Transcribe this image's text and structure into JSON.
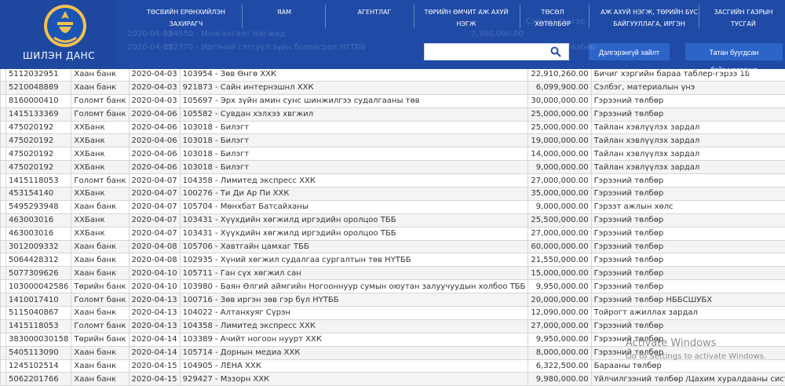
{
  "logo": {
    "title": "ШИЛЭН ДАНС"
  },
  "nav": [
    "ТӨСВИЙН ЕРӨНХИЙЛЭН ЗАХИРАГЧ",
    "ЯАМ",
    "АГЕНТЛАГ",
    "ТӨРИЙН ӨМЧИТ АЖ АХУЙ НЭГЖ",
    "ТӨСӨЛ ХӨТӨЛБӨР",
    "АЖ АХУЙ НЭГЖ, ТӨРИЙН БУС БАЙГУУЛЛАГА, ИРГЭН",
    "ЗАСГИЙН ГАЗРЫН ТУСГАЙ"
  ],
  "search": {
    "placeholder": ""
  },
  "buttons": {
    "advanced": "Дэлгэрэнгүй хайлт",
    "download": "Татан буугдсан байгууллагууд"
  },
  "ghost": {
    "r1": "104550 - Монгалгалт Нагжид",
    "r2": "102770 - Иргэний сэтгүүл зүйн боловсрол НҮТББ",
    "r3": "Сэрүүн тэнгэр",
    "r4": "7,390,000.00",
    "r5": "26,000,000.00",
    "r6": "Гэрээний төлбөр",
    "date1": "2020-04-03",
    "date2": "2020-04-03"
  },
  "rows": [
    [
      "5112032951",
      "Хаан банк",
      "2020-04-03",
      "103954 - Зөв Өнгө ХХК",
      "22,910,260.00",
      "Бичиг хэргийн бараа таблер-гэрээ 18"
    ],
    [
      "5210048889",
      "Хаан банк",
      "2020-04-03",
      "921873 - Сайн интернэшнл ХХК",
      "6,099,900.00",
      "Сэлбэг, материалын үнэ"
    ],
    [
      "8160000410",
      "Голомт банк",
      "2020-04-03",
      "105697 - Эрх зүйн амин сунс шинжилгээ судалгааны төв",
      "30,000,000.00",
      "Гэрээний төлбөр"
    ],
    [
      "1415133369",
      "Голомт банк",
      "2020-04-06",
      "105582 - Сувдан хэлхээ хвгжил",
      "25,000,000.00",
      "Гэрээний төлбөр"
    ],
    [
      "475020192",
      "ХХБанк",
      "2020-04-06",
      "103018 - Билэгт",
      "25,000,000.00",
      "Тайлан хэвлүүлэх зардал"
    ],
    [
      "475020192",
      "ХХБанк",
      "2020-04-06",
      "103018 - Билэгт",
      "19,000,000.00",
      "Тайлан хэвлүүлэх зардал"
    ],
    [
      "475020192",
      "ХХБанк",
      "2020-04-06",
      "103018 - Билэгт",
      "14,000,000.00",
      "Тайлан хэвлүүлэх зардал"
    ],
    [
      "475020192",
      "ХХБанк",
      "2020-04-06",
      "103018 - Билэгт",
      "9,000,000.00",
      "Тайлан хэвлүүлэх зардал"
    ],
    [
      "1415118053",
      "Голомт банк",
      "2020-04-07",
      "104358 - Лимитед экспресс ХХК",
      "27,000,000.00",
      "Гэрээний төлбөр"
    ],
    [
      "453154140",
      "ХХБанк",
      "2020-04-07",
      "100276 - Ти Ди Ар Пи ХХК",
      "35,000,000.00",
      "Гэрээний төлбөр"
    ],
    [
      "5495293948",
      "Хаан банк",
      "2020-04-07",
      "105704 - Мөнхбат Батсайханы",
      "9,000,000.00",
      "Гэрээт ажлын хөлс"
    ],
    [
      "463003016",
      "ХХБанк",
      "2020-04-07",
      "103431 - Хүүхдийн хөгжилд иргэдийн оролцоо ТББ",
      "25,500,000.00",
      "Гэрээний төлбөр"
    ],
    [
      "463003016",
      "ХХБанк",
      "2020-04-07",
      "103431 - Хүүхдийн хөгжилд иргэдийн оролцоо ТББ",
      "27,000,000.00",
      "Гэрээний төлбөр"
    ],
    [
      "3012009332",
      "Хаан банк",
      "2020-04-08",
      "105706 - Хавтгайн цамхаг ТББ",
      "60,000,000.00",
      "Гэрээний төлбөр"
    ],
    [
      "5064428312",
      "Хаан банк",
      "2020-04-08",
      "102935 - Хүний хөгжил судалгаа сургалтын төв НҮТББ",
      "21,550,000.00",
      "Гэрээний төлбөр"
    ],
    [
      "5077309626",
      "Хаан банк",
      "2020-04-10",
      "105711 - Ган сүх хөгжил сан",
      "15,000,000.00",
      "Гэрээний төлбөр"
    ],
    [
      "103000042586",
      "Төрийн банк",
      "2020-04-10",
      "103980 - Баян Өлгий аймгийн Ногооннуур сумын оюутан залуучуудын холбоо ТББ",
      "9,950,000.00",
      "Гэрээний төлбөр"
    ],
    [
      "1410017410",
      "Голомт банк",
      "2020-04-13",
      "100716 - Зөв иргэн зөв гэр бүл НҮТББ",
      "20,000,000.00",
      "Гэрээний төлбөр НББСШУБХ"
    ],
    [
      "5115040867",
      "Хаан банк",
      "2020-04-13",
      "104022 - Алтанхуяг Сүрэн",
      "12,090,000.00",
      "Тойрогт ажиллах зардал"
    ],
    [
      "1415118053",
      "Голомт банк",
      "2020-04-13",
      "104358 - Лимитед экспресс ХХК",
      "27,000,000.00",
      "Гэрээний төлбөр"
    ],
    [
      "383000030158",
      "Төрийн банк",
      "2020-04-14",
      "103389 - Ачийт ногоон нуурт ХХК",
      "9,950,000.00",
      "Гэрээний төлбөр"
    ],
    [
      "5405113090",
      "Хаан банк",
      "2020-04-14",
      "105714 - Дорнын медиа ХХК",
      "8,000,000.00",
      "Гэрээний төлбөр"
    ],
    [
      "1245102514",
      "Хаан банк",
      "2020-04-15",
      "104905 - ЛЕНА ХХК",
      "6,322,500.00",
      "Барааны төлбөр"
    ],
    [
      "5062201766",
      "Хаан банк",
      "2020-04-15",
      "929427 - Мэзорн ХХК",
      "9,980,000.00",
      "Үйлчилгээний төлбөр /Цахим хуралдааны систем/"
    ]
  ],
  "watermark": {
    "title": "Activate Windows",
    "subtitle": "Go to Settings to activate Windows."
  }
}
